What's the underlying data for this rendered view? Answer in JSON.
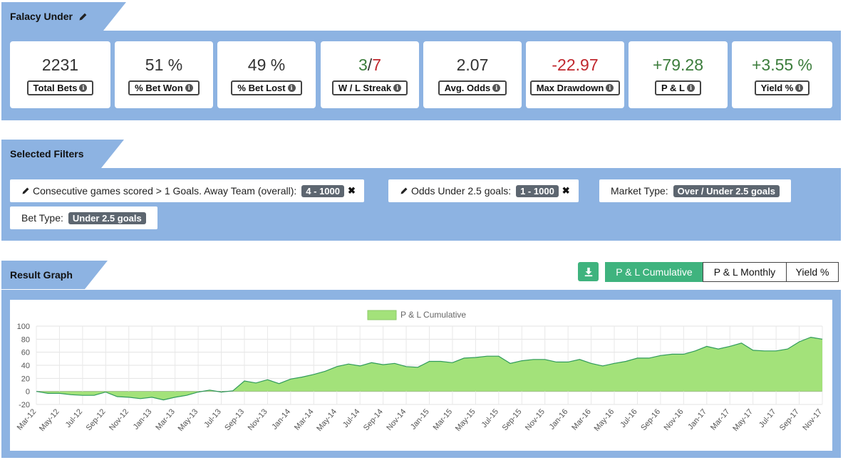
{
  "summary": {
    "title": "Falacy Under",
    "stats": [
      {
        "value": "2231",
        "label": "Total Bets"
      },
      {
        "value": "51 %",
        "label": "% Bet Won"
      },
      {
        "value": "49 %",
        "label": "% Bet Lost"
      },
      {
        "value_won": "3",
        "value_sep": "/",
        "value_lost": "7",
        "label": "W / L Streak"
      },
      {
        "value": "2.07",
        "label": "Avg. Odds"
      },
      {
        "value": "-22.97",
        "label": "Max Drawdown"
      },
      {
        "value": "+79.28",
        "label": "P & L"
      },
      {
        "value": "+3.55 %",
        "label": "Yield %"
      }
    ]
  },
  "filters": {
    "title": "Selected Filters",
    "items": [
      {
        "text": "Consecutive games scored > 1 Goals. Away Team (overall):",
        "badge": "4 - 1000",
        "editable": true,
        "removable": true
      },
      {
        "text": "Odds Under 2.5 goals:",
        "badge": "1 - 1000",
        "editable": true,
        "removable": true
      },
      {
        "text": "Market Type:",
        "badge": "Over / Under 2.5 goals",
        "editable": false,
        "removable": false
      },
      {
        "text": "Bet Type:",
        "badge": "Under 2.5 goals",
        "editable": false,
        "removable": false
      }
    ]
  },
  "graph": {
    "title": "Result Graph",
    "tabs": [
      {
        "label": "P & L Cumulative",
        "active": true
      },
      {
        "label": "P & L Monthly",
        "active": false
      },
      {
        "label": "Yield %",
        "active": false
      }
    ]
  },
  "colors": {
    "band": "#8db3e2",
    "accent": "#3fb37e",
    "area_fill": "#a3e27a",
    "line": "#2f9a5a"
  },
  "chart_data": {
    "type": "area",
    "legend": "P & L Cumulative",
    "legend_position": "top-center",
    "ylim": [
      -20,
      100
    ],
    "yticks": [
      -20,
      0,
      20,
      40,
      60,
      80,
      100
    ],
    "grid": true,
    "x_tick_labels": [
      "Mar-12",
      "May-12",
      "Jul-12",
      "Sep-12",
      "Nov-12",
      "Jan-13",
      "Mar-13",
      "May-13",
      "Jul-13",
      "Sep-13",
      "Nov-13",
      "Jan-14",
      "Mar-14",
      "May-14",
      "Jul-14",
      "Sep-14",
      "Nov-14",
      "Jan-15",
      "Mar-15",
      "May-15",
      "Jul-15",
      "Sep-15",
      "Nov-15",
      "Jan-16",
      "Mar-16",
      "May-16",
      "Jul-16",
      "Sep-16",
      "Nov-16",
      "Jan-17",
      "Mar-17",
      "May-17",
      "Jul-17",
      "Sep-17",
      "Nov-17"
    ],
    "x": [
      "Mar-12",
      "Apr-12",
      "May-12",
      "Jun-12",
      "Jul-12",
      "Aug-12",
      "Sep-12",
      "Oct-12",
      "Nov-12",
      "Dec-12",
      "Jan-13",
      "Feb-13",
      "Mar-13",
      "Apr-13",
      "May-13",
      "Jun-13",
      "Jul-13",
      "Aug-13",
      "Sep-13",
      "Oct-13",
      "Nov-13",
      "Dec-13",
      "Jan-14",
      "Feb-14",
      "Mar-14",
      "Apr-14",
      "May-14",
      "Jun-14",
      "Jul-14",
      "Aug-14",
      "Sep-14",
      "Oct-14",
      "Nov-14",
      "Dec-14",
      "Jan-15",
      "Feb-15",
      "Mar-15",
      "Apr-15",
      "May-15",
      "Jun-15",
      "Jul-15",
      "Aug-15",
      "Sep-15",
      "Oct-15",
      "Nov-15",
      "Dec-15",
      "Jan-16",
      "Feb-16",
      "Mar-16",
      "Apr-16",
      "May-16",
      "Jun-16",
      "Jul-16",
      "Aug-16",
      "Sep-16",
      "Oct-16",
      "Nov-16",
      "Dec-16",
      "Jan-17",
      "Feb-17",
      "Mar-17",
      "Apr-17",
      "May-17",
      "Jun-17",
      "Jul-17",
      "Aug-17",
      "Sep-17",
      "Oct-17",
      "Nov-17"
    ],
    "values": [
      0,
      -3,
      -3,
      -5,
      -6,
      -6,
      -1,
      -8,
      -9,
      -11,
      -9,
      -13,
      -9,
      -6,
      -1,
      2,
      -1,
      1,
      16,
      13,
      18,
      12,
      19,
      22,
      26,
      31,
      38,
      42,
      39,
      44,
      41,
      43,
      38,
      37,
      46,
      46,
      44,
      51,
      52,
      54,
      54,
      43,
      47,
      49,
      49,
      45,
      45,
      49,
      43,
      39,
      43,
      46,
      51,
      51,
      55,
      57,
      57,
      62,
      69,
      65,
      69,
      74,
      63,
      62,
      62,
      65,
      76,
      83,
      80
    ]
  }
}
